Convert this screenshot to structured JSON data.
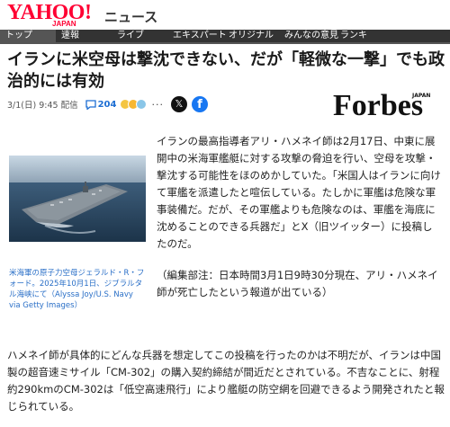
{
  "header": {
    "logo": "YAHOO!",
    "logo_sub": "JAPAN",
    "service": "ニュース"
  },
  "nav": [
    "トップ",
    "速報",
    "ライブ",
    "エキスパート",
    "オリジナル",
    "みんなの意見",
    "ランキ"
  ],
  "article": {
    "title": "イランに米空母は撃沈できない、だが「軽微な一撃」でも政治的には有効",
    "date": "3/1(日) 9:45 配信",
    "comment_count": "204",
    "more": "···",
    "source_sub": "JAPAN",
    "source": "Forbes",
    "caption": "米海軍の原子力空母ジェラルド・R・フォード。2025年10月1日、ジブラルタル海峡にて（Alyssa Joy/U.S. Navy via Getty Images）",
    "para1": "イランの最高指導者アリ・ハメネイ師は2月17日、中東に展開中の米海軍艦艇に対する攻撃の脅迫を行い、空母を攻撃・撃沈する可能性をほのめかしていた。「米国人はイランに向けて軍艦を派遣したと喧伝している。たしかに軍艦は危険な軍事装備だ。だが、その軍艦よりも危険なのは、軍艦を海底に沈めることのできる兵器だ」とX（旧ツイッター）に投稿したのだ。",
    "para2": "（編集部注：日本時間3月1日9時30分現在、アリ・ハメネイ師が死亡したという報道が出ている）",
    "para3": "ハメネイ師が具体的にどんな兵器を想定してこの投稿を行ったのかは不明だが、イランは中国製の超音速ミサイル「CM-302」の購入契約締結が間近だとされている。不吉なことに、射程約290kmのCM-302は「低空高速飛行」により艦艇の防空網を回避できるよう開発されたと報じられている。"
  },
  "colors": {
    "brand": "#ff0033",
    "link": "#2a6fc7",
    "x": "#111111",
    "facebook": "#1877f2"
  }
}
